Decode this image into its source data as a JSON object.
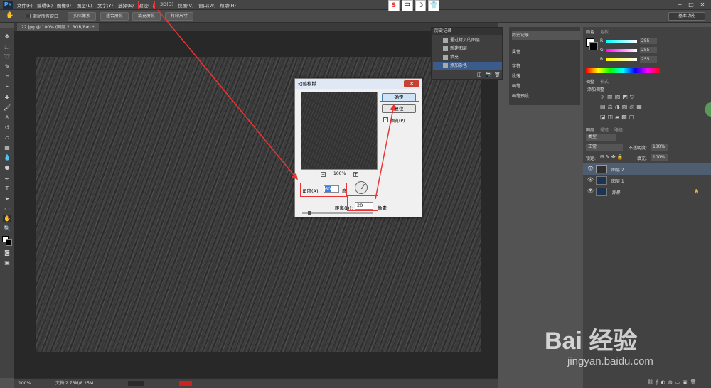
{
  "app_logo": "Ps",
  "menu": [
    "文件(F)",
    "编辑(E)",
    "图像(I)",
    "图层(L)",
    "文字(Y)",
    "选择(S)",
    "滤镜(T)",
    "3D(D)",
    "视图(V)",
    "窗口(W)",
    "帮助(H)"
  ],
  "window_controls": [
    "─",
    "□",
    "✕"
  ],
  "options": {
    "checkbox_label": "滚动所有窗口",
    "buttons": [
      "实际像素",
      "适合屏幕",
      "填充屏幕",
      "打印尺寸"
    ],
    "workspace": "基本功能"
  },
  "doc_tab": "22.jpg @ 100% (图层 2, RGB/8#) *",
  "status": {
    "zoom": "100%",
    "doc": "文档:2.75M/8.25M"
  },
  "sogou": [
    "S",
    "中",
    "☽",
    "👕"
  ],
  "history": {
    "title": "历史记录",
    "items": [
      "通过拷贝的图层",
      "新建图层",
      "填充",
      "添加杂色"
    ]
  },
  "side_panel": [
    "历史记录",
    "属性",
    "字符",
    "段落",
    "画笔",
    "画笔预设"
  ],
  "color_panel": {
    "tabs": [
      "颜色",
      "色板"
    ],
    "channels": [
      "R",
      "G",
      "B"
    ],
    "values": [
      "255",
      "255",
      "255"
    ]
  },
  "adjust_panel": {
    "tabs": [
      "调整",
      "样式"
    ],
    "label": "添加调整"
  },
  "layers_panel": {
    "tabs": [
      "图层",
      "通道",
      "路径"
    ],
    "kind": "类型",
    "blend": "正常",
    "opacity_label": "不透明度:",
    "opacity": "100%",
    "lock_label": "锁定:",
    "fill_label": "填充:",
    "fill": "100%",
    "layers": [
      "图层 2",
      "图层 1",
      "背景"
    ]
  },
  "dialog": {
    "title": "动感模糊",
    "close": "✕",
    "ok": "确定",
    "reset": "复位",
    "preview_label": "预览(P)",
    "zoom": "100%",
    "angle_label": "角度(A):",
    "angle_value": "60",
    "angle_unit": "度",
    "distance_label": "距离(D):",
    "distance_value": "20",
    "distance_unit": "像素"
  },
  "watermark": {
    "brand": "Bai 经验",
    "url": "jingyan.baidu.com"
  }
}
